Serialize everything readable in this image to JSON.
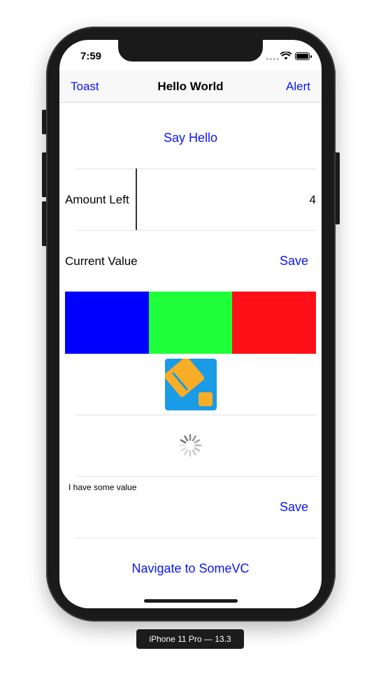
{
  "status_bar": {
    "time": "7:59"
  },
  "nav": {
    "left": "Toast",
    "title": "Hello World",
    "right": "Alert"
  },
  "content": {
    "say_hello": "Say Hello",
    "amount_label": "Amount Left",
    "amount_value": "4",
    "current_label": "Current Value",
    "save_label": "Save",
    "colors": [
      "#0000ff",
      "#1fff3a",
      "#ff1018"
    ],
    "small_text": "I have some value",
    "save_label_2": "Save",
    "navigate": "Navigate to SomeVC"
  },
  "device_label": "iPhone 11 Pro — 13.3"
}
